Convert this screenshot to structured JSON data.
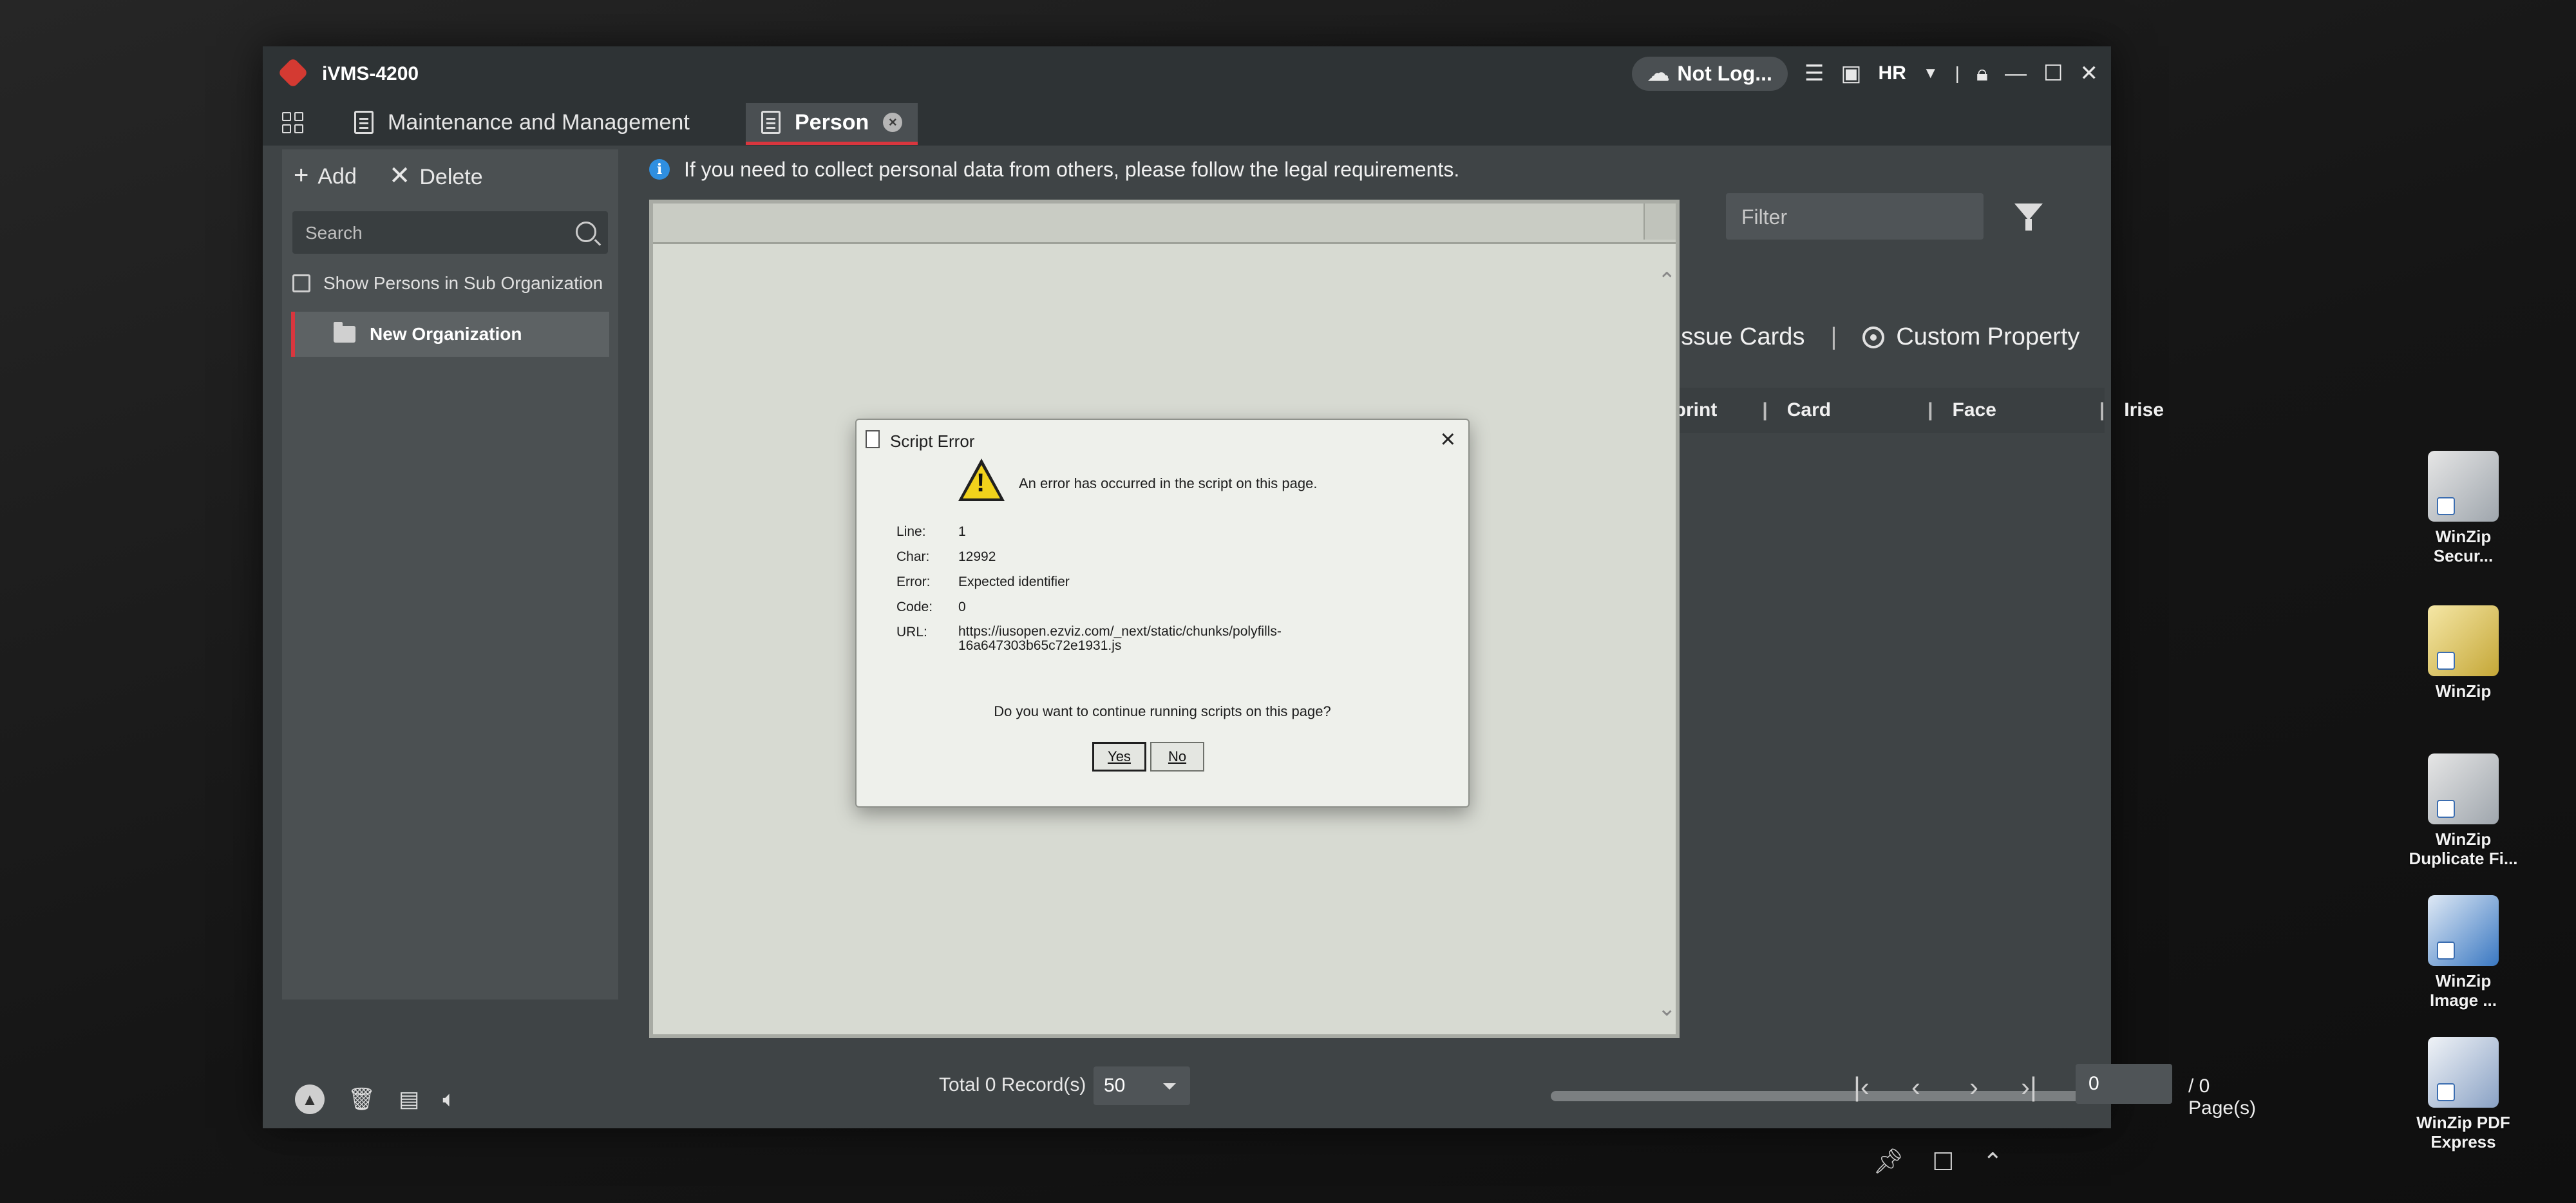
{
  "app": {
    "title": "iVMS-4200",
    "login_status": "Not Log...",
    "language": "HR"
  },
  "tabs": [
    {
      "label": "Maintenance and Management"
    },
    {
      "label": "Person"
    }
  ],
  "sidebar": {
    "add_label": "Add",
    "delete_label": "Delete",
    "search_placeholder": "Search",
    "show_sub_label": "Show Persons in Sub Organization",
    "org_item": "New Organization"
  },
  "main": {
    "info_banner": "If you need to collect personal data from others, please follow the legal requirements.",
    "filter_placeholder": "Filter",
    "actions": {
      "batch_issue_partial": "h Issue Cards",
      "custom_property": "Custom Property"
    },
    "columns": [
      "rprint",
      "Card",
      "Face",
      "Irise"
    ],
    "pager": {
      "total": "Total 0 Record(s)",
      "page_size": "50",
      "page_input": "0",
      "page_total": "/ 0 Page(s)"
    }
  },
  "dialog": {
    "title": "Script Error",
    "message": "An error has occurred in the script on this page.",
    "fields": {
      "line_label": "Line:",
      "line_value": "1",
      "char_label": "Char:",
      "char_value": "12992",
      "error_label": "Error:",
      "error_value": "Expected identifier",
      "code_label": "Code:",
      "code_value": "0",
      "url_label": "URL:",
      "url_value_1": "https://iusopen.ezviz.com/_next/static/chunks/polyfills-",
      "url_value_2": "16a647303b65c72e1931.js"
    },
    "question": "Do you want to continue running scripts on this page?",
    "yes_label": "Yes",
    "no_label": "No"
  },
  "desktop": {
    "icons": [
      {
        "label_1": "WinZip",
        "label_2": "Secur..."
      },
      {
        "label_1": "WinZip",
        "label_2": ""
      },
      {
        "label_1": "WinZip",
        "label_2": "Duplicate Fi..."
      },
      {
        "label_1": "WinZip",
        "label_2": "Image ..."
      },
      {
        "label_1": "WinZip PDF",
        "label_2": "Express"
      }
    ]
  }
}
